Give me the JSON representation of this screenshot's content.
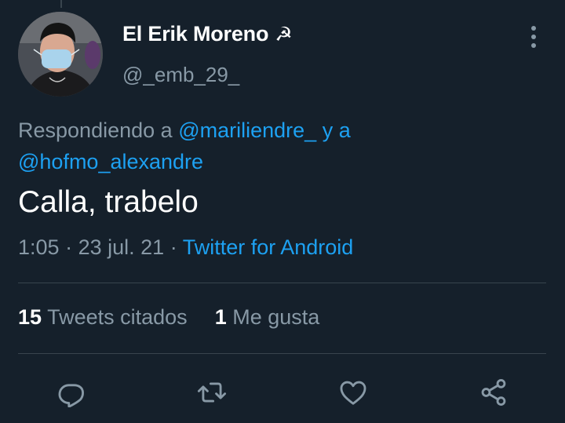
{
  "author": {
    "display_name": "El Erik Moreno",
    "name_emoji": "☭",
    "handle": "@_emb_29_"
  },
  "reply_context": {
    "prefix": "Respondiendo a",
    "mention_1": "@mariliendre_",
    "connector": "y a",
    "mention_2": "@hofmo_alexandre"
  },
  "tweet": {
    "text": "Calla, trabelo",
    "time": "1:05",
    "separator": "·",
    "date": "23 jul. 21",
    "source": "Twitter for Android"
  },
  "stats": {
    "quotes_count": "15",
    "quotes_label": "Tweets citados",
    "likes_count": "1",
    "likes_label": "Me gusta"
  },
  "actions": {
    "icons": [
      "reply-icon",
      "retweet-icon",
      "like-icon",
      "share-icon"
    ]
  },
  "colors": {
    "background": "#15202b",
    "secondary_text": "#8899a6",
    "accent": "#1da1f2",
    "divider": "#38444d"
  }
}
